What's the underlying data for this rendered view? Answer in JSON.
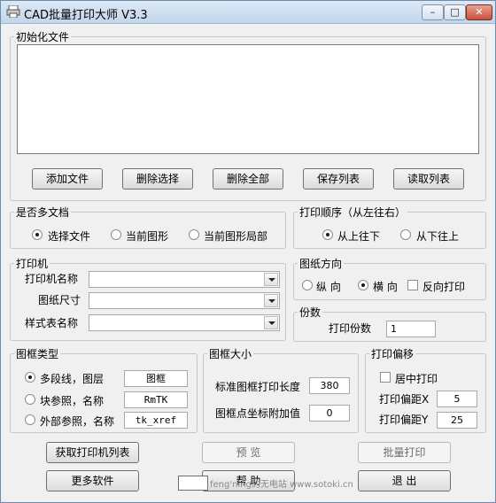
{
  "title": "CAD批量打印大师 V3.3",
  "window_buttons": {
    "min": "–",
    "max": "□",
    "close": "✕"
  },
  "init_files": {
    "legend": "初始化文件",
    "buttons": [
      "添加文件",
      "删除选择",
      "删除全部",
      "保存列表",
      "读取列表"
    ]
  },
  "multi_doc": {
    "legend": "是否多文档",
    "options": [
      "选择文件",
      "当前图形",
      "当前图形局部"
    ],
    "selected": "选择文件"
  },
  "print_order": {
    "legend": "打印顺序（从左往右）",
    "options": [
      "从上往下",
      "从下往上"
    ],
    "selected": "从上往下"
  },
  "printer": {
    "legend": "打印机",
    "printer_name_label": "打印机名称",
    "paper_size_label": "图纸尺寸",
    "style_table_label": "样式表名称",
    "printer_name": "",
    "paper_size": "",
    "style_table": ""
  },
  "orientation": {
    "legend": "图纸方向",
    "portrait": "纵 向",
    "landscape": "横 向",
    "reverse": "反向打印",
    "selected": "横 向",
    "reverse_checked": false
  },
  "copies": {
    "legend": "份数",
    "label": "打印份数",
    "value": "1"
  },
  "frame_type": {
    "legend": "图框类型",
    "options": [
      {
        "label": "多段线，图层",
        "value": "图框"
      },
      {
        "label": "块参照，名称",
        "value": "RmTK"
      },
      {
        "label": "外部参照，名称",
        "value": "tk_xref"
      }
    ],
    "selected": "多段线，图层"
  },
  "frame_size": {
    "legend": "图框大小",
    "std_length_label": "标准图框打印长度",
    "std_length_value": "380",
    "offset_label": "图框点坐标附加值",
    "offset_value": "0"
  },
  "print_offset": {
    "legend": "打印偏移",
    "center_label": "居中打印",
    "center_checked": false,
    "x_label": "打印偏距X",
    "x_value": "5",
    "y_label": "打印偏距Y",
    "y_value": "25"
  },
  "bottom_buttons": {
    "get_printers": "获取打印机列表",
    "preview": "预 览",
    "batch_print": "批量打印",
    "more_software": "更多软件",
    "help": "帮 助",
    "exit": "退 出"
  },
  "watermark": "feng'ning的无电站 www.sotoki.cn"
}
